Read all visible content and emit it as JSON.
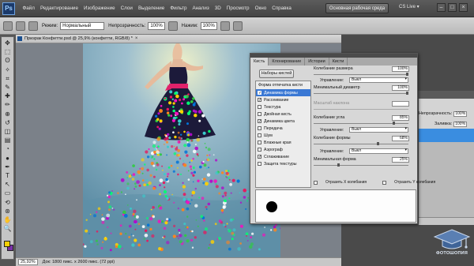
{
  "menubar": {
    "logo": "Ps",
    "items": [
      "Файл",
      "Редактирование",
      "Изображение",
      "Слои",
      "Выделение",
      "Фильтр",
      "Анализ",
      "3D",
      "Просмотр",
      "Окно",
      "Справка"
    ],
    "zoom": "25,9",
    "workspace_button": "Основная рабочая среда",
    "cs_live": "CS Live ▾",
    "window_controls": [
      "–",
      "□",
      "×"
    ]
  },
  "options_bar": {
    "mode_label": "Режим:",
    "mode_value": "Нормальный",
    "opacity_label": "Непрозрачность:",
    "opacity_value": "100%",
    "flow_label": "Нажим:",
    "flow_value": "100%"
  },
  "toolbox": {
    "icons": [
      "move-icon",
      "marquee-icon",
      "lasso-icon",
      "quick-select-icon",
      "crop-icon",
      "eyedropper-icon",
      "healing-icon",
      "brush-icon",
      "stamp-icon",
      "history-brush-icon",
      "eraser-icon",
      "gradient-icon",
      "blur-icon",
      "dodge-icon",
      "pen-icon",
      "type-icon",
      "path-select-icon",
      "shape-icon",
      "3d-rotate-icon",
      "3d-camera-icon",
      "hand-icon",
      "zoom-icon"
    ],
    "glyphs": [
      "✥",
      "⬚",
      "ʘ",
      "✧",
      "⌗",
      "✎",
      "✚",
      "✏",
      "⊕",
      "↺",
      "◫",
      "▤",
      "◔",
      "●",
      "✒",
      "T",
      "↖",
      "▭",
      "⟲",
      "⊛",
      "✋",
      "🔍"
    ],
    "foreground_color": "#f5cf05",
    "background_color": "#7a2fa8"
  },
  "document": {
    "tab_title": "Призрак Конфетти.psd @ 25,9% (конфетти, RGB/8) *",
    "tab_close": "×",
    "zoom": "25,92%",
    "info": "Док: 1800 пикс. x 2600 пикс. (72 ppi)"
  },
  "brush_panel": {
    "tabs": [
      "Кисть",
      "Клонирование",
      "Истории",
      "Кисти"
    ],
    "presets_button": "Наборы кистей",
    "tip_shape_header": "Форма отпечатка кисти",
    "options": [
      {
        "label": "Динамика формы",
        "checked": true,
        "selected": true
      },
      {
        "label": "Рассеивание",
        "checked": true,
        "selected": false
      },
      {
        "label": "Текстура",
        "checked": false,
        "selected": false
      },
      {
        "label": "Двойная кисть",
        "checked": false,
        "selected": false
      },
      {
        "label": "Динамика цвета",
        "checked": true,
        "selected": false
      },
      {
        "label": "Передача",
        "checked": false,
        "selected": false
      },
      {
        "label": "Шум",
        "checked": false,
        "selected": false
      },
      {
        "label": "Влажные края",
        "checked": false,
        "selected": false
      },
      {
        "label": "Аэрограф",
        "checked": false,
        "selected": false
      },
      {
        "label": "Сглаживание",
        "checked": true,
        "selected": false
      },
      {
        "label": "Защита текстуры",
        "checked": false,
        "selected": false
      }
    ],
    "size_jitter_label": "Колебание размера",
    "size_jitter_value": "100%",
    "control_label": "Управление:",
    "control_off": "Выкл",
    "min_diameter_label": "Минимальный диаметр",
    "min_diameter_value": "100%",
    "tilt_scale_label": "Масштаб наклона",
    "angle_jitter_label": "Колебание угла",
    "angle_jitter_value": "85%",
    "roundness_jitter_label": "Колебание формы",
    "roundness_jitter_value": "68%",
    "min_roundness_label": "Минимальная форма",
    "min_roundness_value": "25%",
    "flip_x_label": "Отразить X колебания",
    "flip_y_label": "Отразить Y колебания"
  },
  "layers_panel": {
    "opacity_label": "Непрозрачность:",
    "opacity_value": "100%",
    "fill_label": "Заливка:",
    "fill_value": "100%"
  },
  "watermark": {
    "text": "ФОТОШОПИЯ"
  }
}
